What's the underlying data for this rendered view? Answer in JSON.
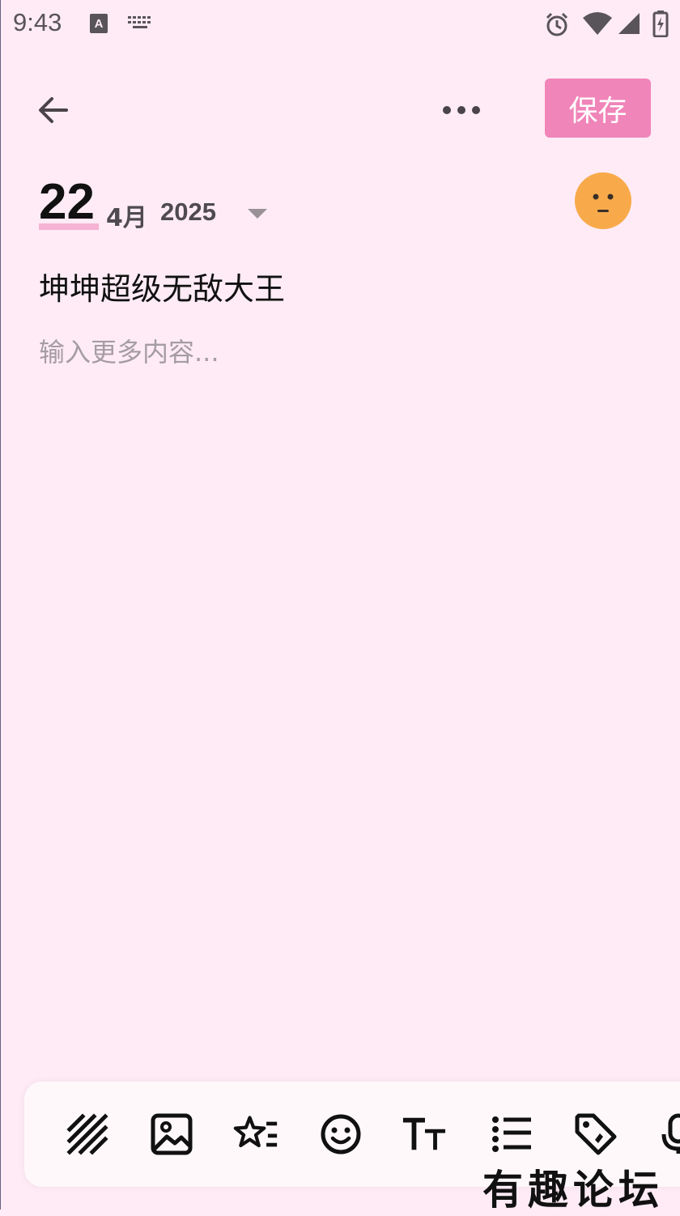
{
  "status_bar": {
    "time": "9:43",
    "icons": [
      "keyboard-a-icon",
      "keyboard-icon",
      "alarm-icon",
      "wifi-icon",
      "signal-icon",
      "battery-charging-icon"
    ]
  },
  "app_bar": {
    "back_icon": "arrow-left-icon",
    "more_icon": "more-horizontal-icon",
    "save_label": "保存",
    "save_color": "#F085B9"
  },
  "entry": {
    "day": "22",
    "month": "4月",
    "year": "2025",
    "mood_icon": "neutral-face-icon",
    "mood_color": "#F8AA4B",
    "title": "坤坤超级无敌大王",
    "content_placeholder": "输入更多内容..."
  },
  "toolbar": {
    "items": [
      "background-pattern-icon",
      "image-icon",
      "star-list-icon",
      "emoji-icon",
      "text-size-icon",
      "list-icon",
      "tag-icon",
      "microphone-icon"
    ]
  },
  "watermark": "有趣论坛",
  "colors": {
    "background": "#FEEBF5",
    "toolbar_bg": "#FFF8FB",
    "accent": "#F085B9",
    "placeholder": "#A69CA4"
  }
}
